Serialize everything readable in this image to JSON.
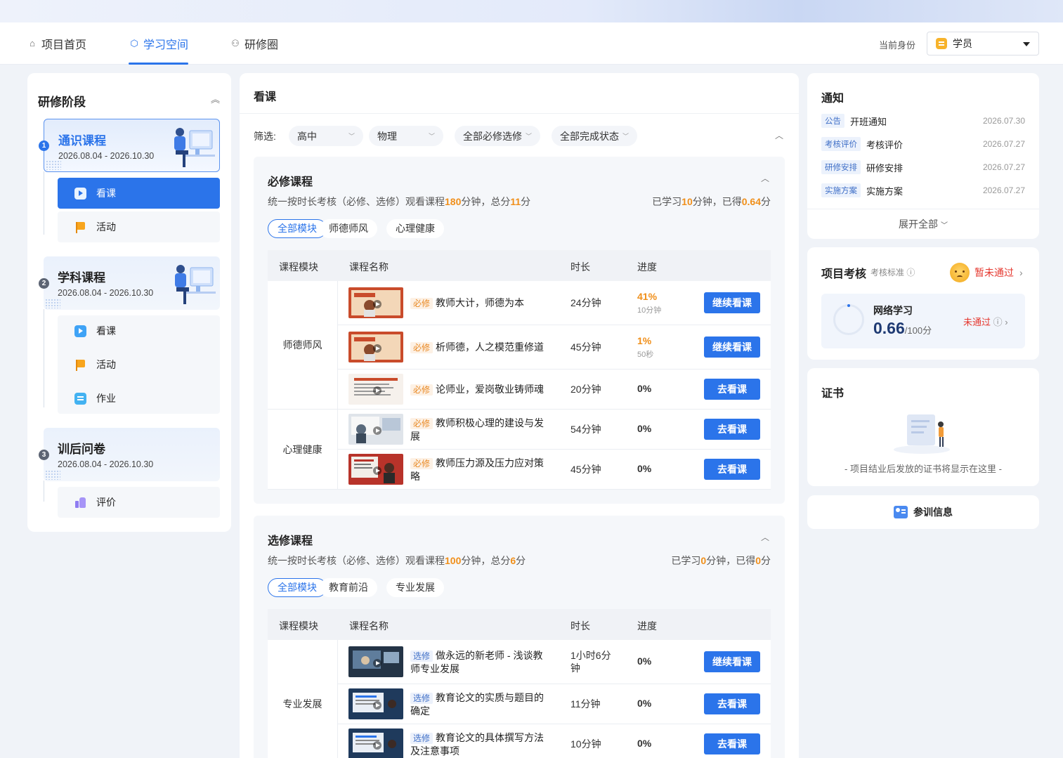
{
  "nav": {
    "tabs": [
      {
        "label": "项目首页",
        "icon": "home-icon"
      },
      {
        "label": "学习空间",
        "icon": "cube-icon"
      },
      {
        "label": "研修圈",
        "icon": "people-icon"
      }
    ],
    "identity_label": "当前身份",
    "identity_value": "学员"
  },
  "sidebar": {
    "title": "研修阶段",
    "stages": [
      {
        "num": "1",
        "name": "通识课程",
        "date": "2026.08.04 - 2026.10.30",
        "items": [
          {
            "label": "看课",
            "icon": "play-icon"
          },
          {
            "label": "活动",
            "icon": "flag-icon"
          }
        ]
      },
      {
        "num": "2",
        "name": "学科课程",
        "date": "2026.08.04 - 2026.10.30",
        "items": [
          {
            "label": "看课",
            "icon": "play-icon"
          },
          {
            "label": "活动",
            "icon": "flag-icon"
          },
          {
            "label": "作业",
            "icon": "homework-icon"
          }
        ]
      },
      {
        "num": "3",
        "name": "训后问卷",
        "date": "2026.08.04 - 2026.10.30",
        "items": [
          {
            "label": "评价",
            "icon": "thumbs-up-icon"
          }
        ]
      }
    ]
  },
  "main": {
    "title": "看课",
    "filter_label": "筛选:",
    "filters": [
      "高中",
      "物理",
      "全部必修选修",
      "全部完成状态"
    ],
    "required": {
      "title": "必修课程",
      "desc_prefix": "统一按时长考核（必修、选修）观看课程",
      "desc_minutes": "180",
      "desc_mid": "分钟，总分",
      "desc_score": "11",
      "desc_suffix": "分",
      "learned_prefix": "已学习",
      "learned_minutes": "10",
      "learned_mid": "分钟，已得",
      "learned_score": "0.64",
      "learned_suffix": "分",
      "chips": [
        "全部模块",
        "师德师风",
        "心理健康"
      ],
      "headers": [
        "课程模块",
        "课程名称",
        "时长",
        "进度"
      ],
      "modules": [
        "师德师风",
        "心理健康"
      ],
      "rows": [
        {
          "tag": "必修",
          "name": "教师大计，师德为本",
          "duration": "24分钟",
          "progress": "41%",
          "sub": "10分钟",
          "btn": "继续看课"
        },
        {
          "tag": "必修",
          "name": "析师德，人之模范重修道",
          "duration": "45分钟",
          "progress": "1%",
          "sub": "50秒",
          "btn": "继续看课"
        },
        {
          "tag": "必修",
          "name": "论师业，爱岗敬业铸师魂",
          "duration": "20分钟",
          "progress": "0%",
          "sub": "",
          "btn": "去看课"
        },
        {
          "tag": "必修",
          "name": "教师积极心理的建设与发展",
          "duration": "54分钟",
          "progress": "0%",
          "sub": "",
          "btn": "去看课"
        },
        {
          "tag": "必修",
          "name": "教师压力源及压力应对策略",
          "duration": "45分钟",
          "progress": "0%",
          "sub": "",
          "btn": "去看课"
        }
      ]
    },
    "elective": {
      "title": "选修课程",
      "desc_prefix": "统一按时长考核（必修、选修）观看课程",
      "desc_minutes": "100",
      "desc_mid": "分钟，总分",
      "desc_score": "6",
      "desc_suffix": "分",
      "learned_prefix": "已学习",
      "learned_minutes": "0",
      "learned_mid": "分钟，已得",
      "learned_score": "0",
      "learned_suffix": "分",
      "chips": [
        "全部模块",
        "教育前沿",
        "专业发展"
      ],
      "headers": [
        "课程模块",
        "课程名称",
        "时长",
        "进度"
      ],
      "modules": [
        "专业发展"
      ],
      "rows": [
        {
          "tag": "选修",
          "name": "做永远的新老师 - 浅谈教师专业发展",
          "duration": "1小时6分钟",
          "progress": "0%",
          "btn": "继续看课"
        },
        {
          "tag": "选修",
          "name": "教育论文的实质与题目的确定",
          "duration": "11分钟",
          "progress": "0%",
          "btn": "去看课"
        },
        {
          "tag": "选修",
          "name": "教育论文的具体撰写方法及注意事项",
          "duration": "10分钟",
          "progress": "0%",
          "btn": "去看课"
        }
      ]
    }
  },
  "notice": {
    "title": "通知",
    "items": [
      {
        "tag": "公告",
        "text": "开班通知",
        "date": "2026.07.30"
      },
      {
        "tag": "考核评价",
        "text": "考核评价",
        "date": "2026.07.27"
      },
      {
        "tag": "研修安排",
        "text": "研修安排",
        "date": "2026.07.27"
      },
      {
        "tag": "实施方案",
        "text": "实施方案",
        "date": "2026.07.27"
      }
    ],
    "expand": "展开全部"
  },
  "assessment": {
    "title": "项目考核",
    "standard": "考核标准",
    "status": "暂未通过",
    "item_label": "网络学习",
    "score": "0.66",
    "total": "/100分",
    "result": "未通过",
    "progress_fraction": 0.0066
  },
  "certificate": {
    "title": "证书",
    "empty_text": "- 项目结业后发放的证书将显示在这里 -"
  },
  "training_info": {
    "label": "参训信息"
  },
  "colors": {
    "primary": "#2b74ea",
    "accent_orange": "#f08f1a",
    "danger": "#e5382f"
  }
}
